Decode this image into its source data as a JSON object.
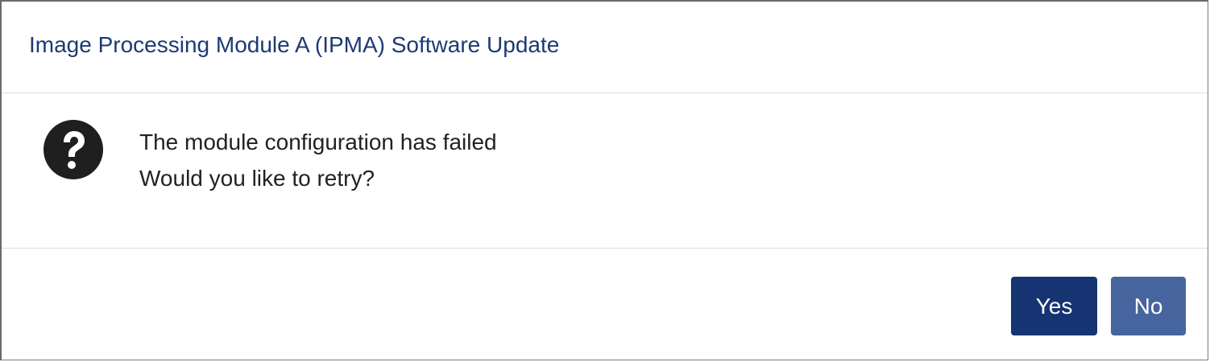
{
  "dialog": {
    "title": "Image Processing Module A (IPMA) Software Update",
    "icon": "question-circle-icon",
    "message_line1": "The module configuration has failed",
    "message_line2": "Would you like to retry?",
    "buttons": {
      "yes_label": "Yes",
      "no_label": "No"
    }
  },
  "colors": {
    "title_text": "#1d3a73",
    "primary_button": "#163372",
    "secondary_button": "#46649e",
    "icon": "#1f1f1f"
  }
}
